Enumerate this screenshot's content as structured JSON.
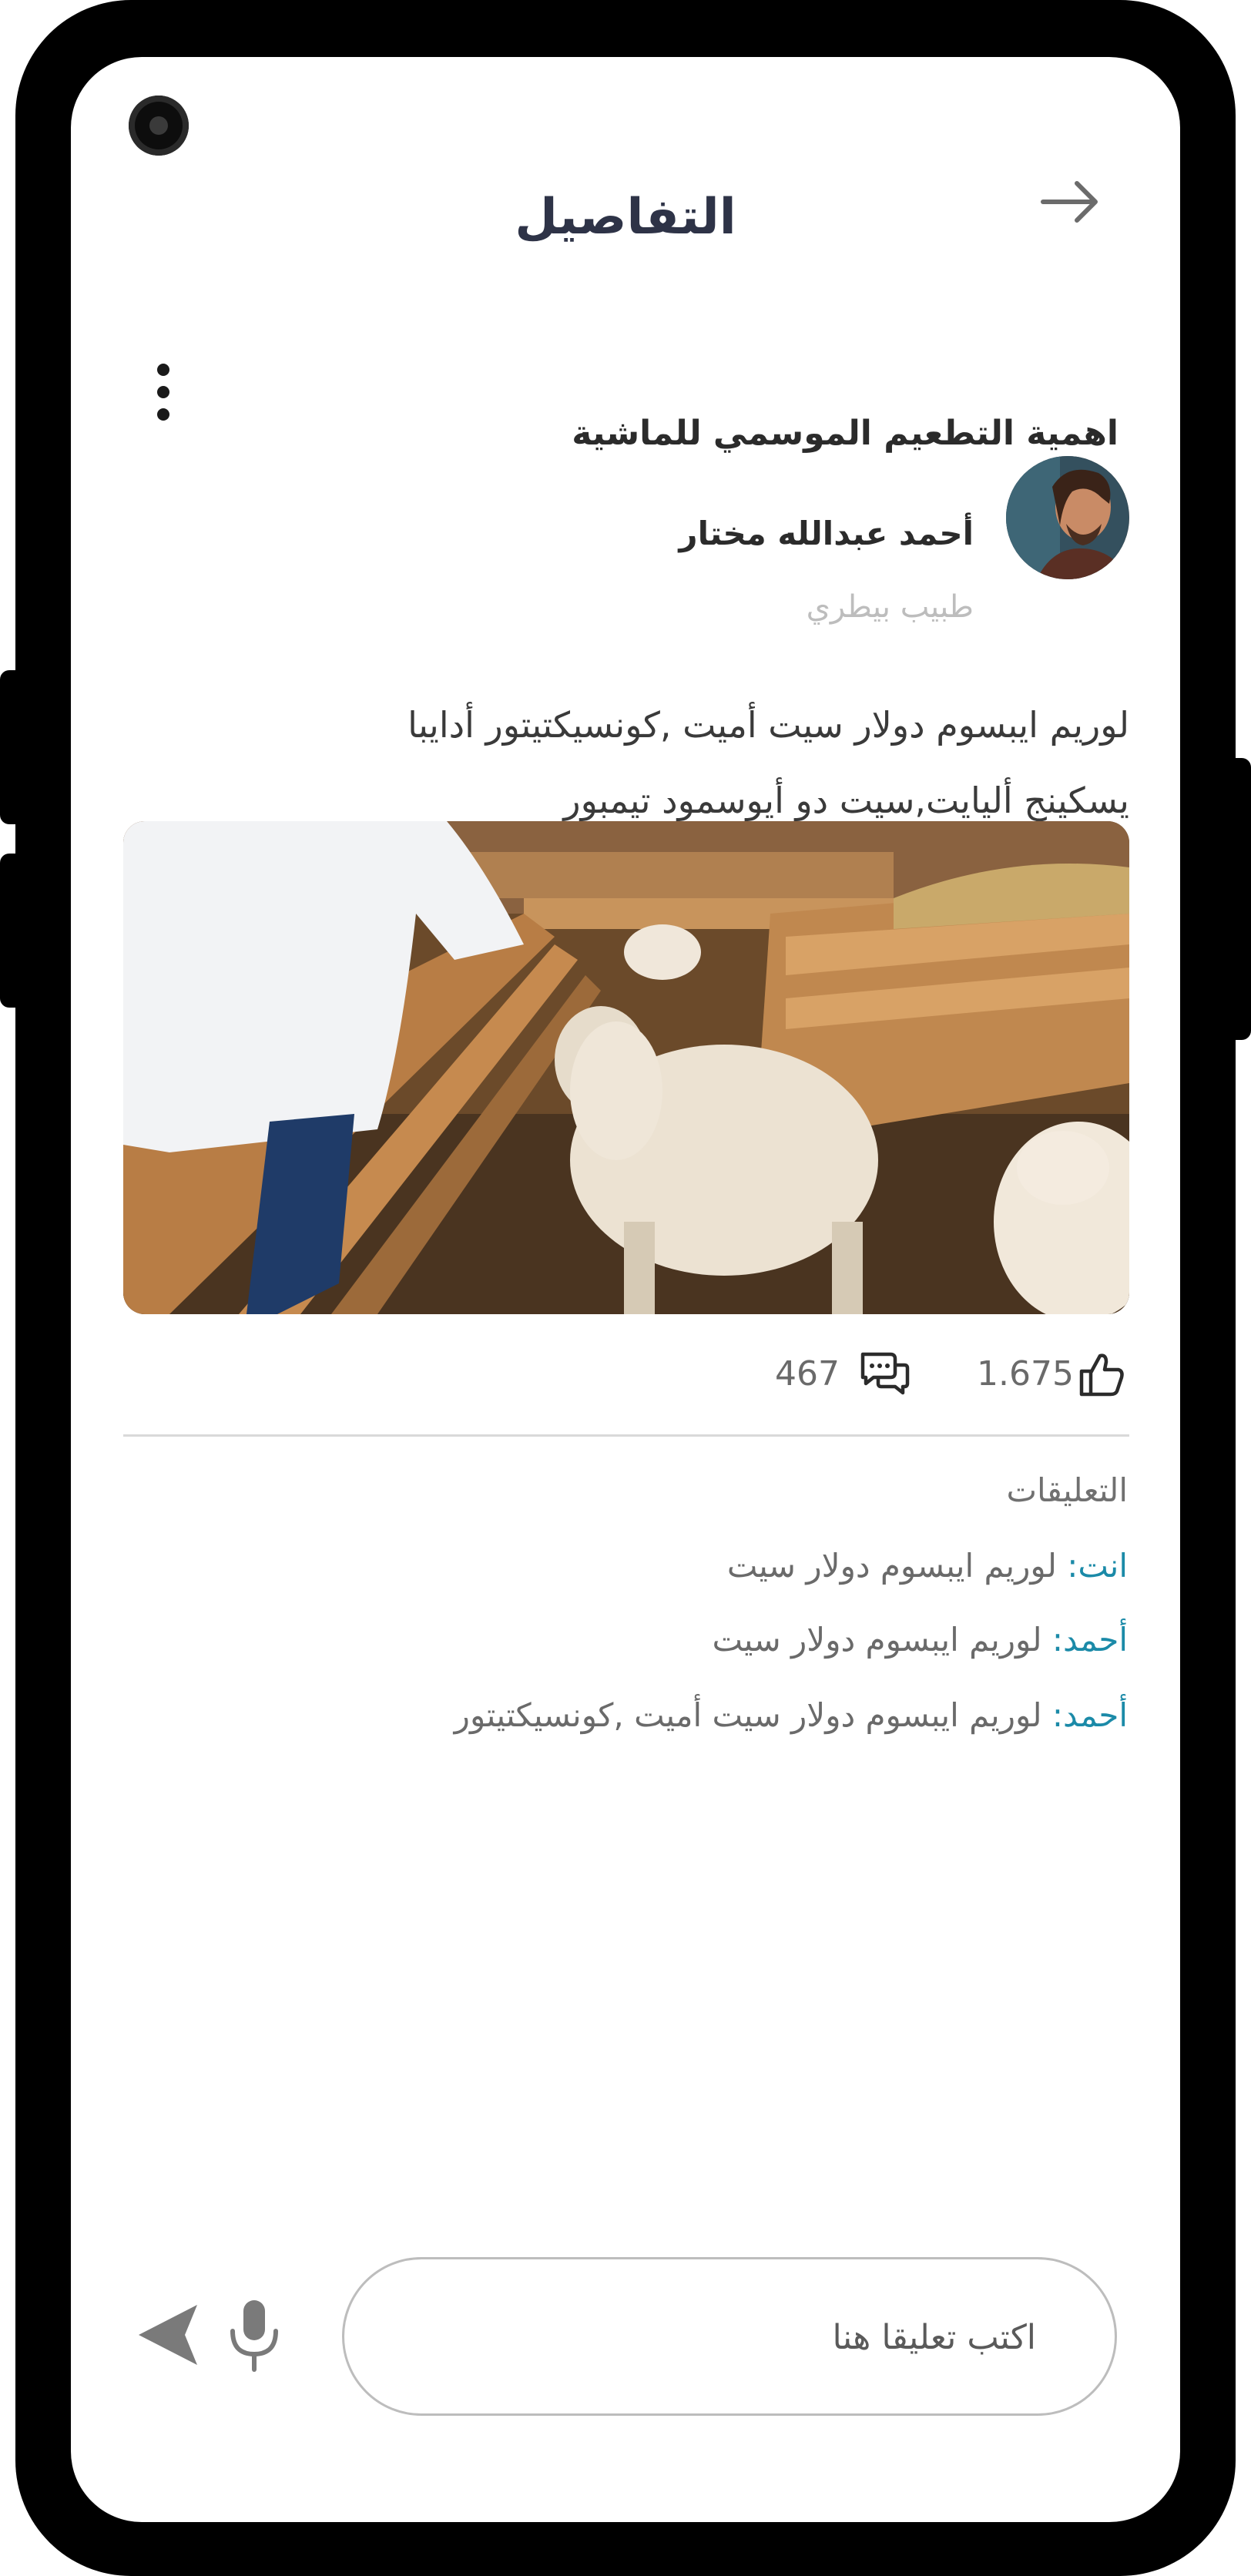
{
  "header": {
    "title": "التفاصيل",
    "back_icon": "arrow-right-icon"
  },
  "post": {
    "title": "اهمية التطعيم الموسمي للماشية",
    "author": {
      "name": "أحمد عبدالله مختار",
      "role": "طبيب بيطري"
    },
    "body_line1": "لوريم ايبسوم دولار سيت أميت ,كونسيكتيتور أدايبا",
    "body_line2": "يسكينج أليايت,سيت دو أيوسمود تيمبور",
    "likes": "1.675",
    "comments_count": "467"
  },
  "comments": {
    "header": "التعليقات",
    "items": [
      {
        "author": "انت:",
        "text": "لوريم ايبسوم دولار سيت"
      },
      {
        "author": "أحمد:",
        "text": "لوريم ايبسوم دولار سيت"
      },
      {
        "author": "أحمد:",
        "text": "لوريم ايبسوم دولار سيت أميت ,كونسيكتيتور"
      }
    ]
  },
  "composer": {
    "placeholder": "اكتب تعليقا هنا",
    "mic_icon": "microphone-icon",
    "send_icon": "send-icon"
  },
  "colors": {
    "accent": "#1b8aa8",
    "title": "#2e3347",
    "muted": "#bdbdbd"
  }
}
